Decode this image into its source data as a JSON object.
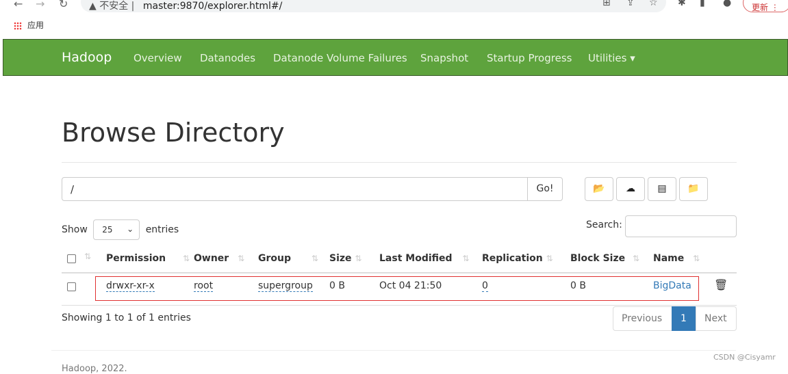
{
  "browser": {
    "security_label": "不安全",
    "url": "master:9870/explorer.html#/",
    "update_label": "更新",
    "bookmark_apps": "应用"
  },
  "navbar": {
    "brand": "Hadoop",
    "items": [
      "Overview",
      "Datanodes",
      "Datanode Volume Failures",
      "Snapshot",
      "Startup Progress",
      "Utilities ▾"
    ],
    "color": "#5ea33d"
  },
  "page": {
    "title": "Browse Directory"
  },
  "path": {
    "value": "/",
    "go_label": "Go!"
  },
  "toolbar": {
    "icons": [
      "folder-open-icon",
      "cloud-upload-icon",
      "list-alt-icon",
      "folder-create-icon"
    ]
  },
  "table_controls": {
    "show_label": "Show",
    "entries_value": "25",
    "entries_label": "entries",
    "search_label": "Search:",
    "search_value": ""
  },
  "table": {
    "headers": [
      "Permission",
      "Owner",
      "Group",
      "Size",
      "Last Modified",
      "Replication",
      "Block Size",
      "Name"
    ],
    "rows": [
      {
        "permission": "drwxr-xr-x",
        "owner": "root",
        "group": "supergroup",
        "size": "0 B",
        "last_modified": "Oct 04 21:50",
        "replication": "0",
        "block_size": "0 B",
        "name": "BigData"
      }
    ]
  },
  "pagination": {
    "info": "Showing 1 to 1 of 1 entries",
    "previous": "Previous",
    "current": "1",
    "next": "Next"
  },
  "footer": {
    "text": "Hadoop, 2022."
  },
  "watermark": "CSDN @Cisyamr"
}
